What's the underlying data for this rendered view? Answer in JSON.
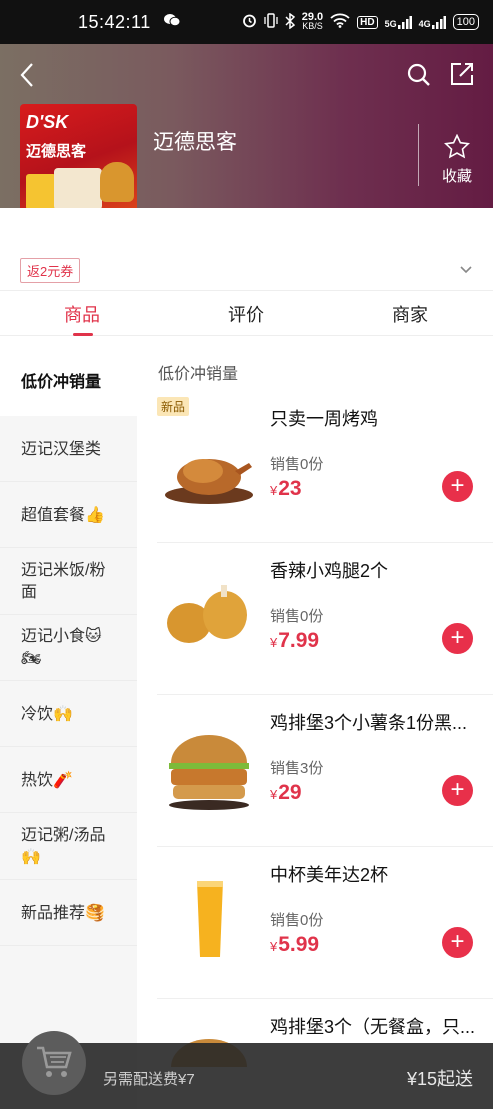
{
  "status_bar": {
    "time": "15:42:11",
    "speed_value": "29.0",
    "speed_unit": "KB/S",
    "hd": "HD",
    "net1": "5G",
    "net2": "4G",
    "battery": "100"
  },
  "store": {
    "name": "迈德思客",
    "logo_text_en": "D'SK",
    "logo_text_cn": "迈德思客",
    "favorite_label": "收藏"
  },
  "coupon": {
    "label": "返2元券"
  },
  "tabs": [
    {
      "label": "商品",
      "active": true
    },
    {
      "label": "评价",
      "active": false
    },
    {
      "label": "商家",
      "active": false
    }
  ],
  "categories": [
    {
      "label": "低价冲销量",
      "active": true
    },
    {
      "label": "迈记汉堡类"
    },
    {
      "label": "超值套餐👍"
    },
    {
      "label": "迈记米饭/粉面"
    },
    {
      "label": "迈记小食🐱🏍"
    },
    {
      "label": "冷饮🙌"
    },
    {
      "label": "热饮🧨"
    },
    {
      "label": "迈记粥/汤品🙌"
    },
    {
      "label": "新品推荐🥞"
    }
  ],
  "section_title": "低价冲销量",
  "products": [
    {
      "name": "只卖一周烤鸡",
      "sales": "销售0份",
      "currency": "¥",
      "price": "23",
      "tag": "新品",
      "image": "roast-chicken"
    },
    {
      "name": "香辣小鸡腿2个",
      "sales": "销售0份",
      "currency": "¥",
      "price": "7.99",
      "image": "fried-drumsticks"
    },
    {
      "name": "鸡排堡3个小薯条1份黑...",
      "sales": "销售3份",
      "currency": "¥",
      "price": "29",
      "image": "chicken-burger"
    },
    {
      "name": "中杯美年达2杯",
      "sales": "销售0份",
      "currency": "¥",
      "price": "5.99",
      "image": "orange-soda"
    },
    {
      "name": "鸡排堡3个（无餐盒，只...",
      "sales": "",
      "currency": "",
      "price": "",
      "image": "chicken-burger"
    }
  ],
  "bottom_bar": {
    "delivery_fee": "另需配送费¥7",
    "min_order": "¥15起送"
  },
  "colors": {
    "accent": "#e0334a",
    "header_start": "#7b6f63",
    "header_end": "#641c43"
  }
}
